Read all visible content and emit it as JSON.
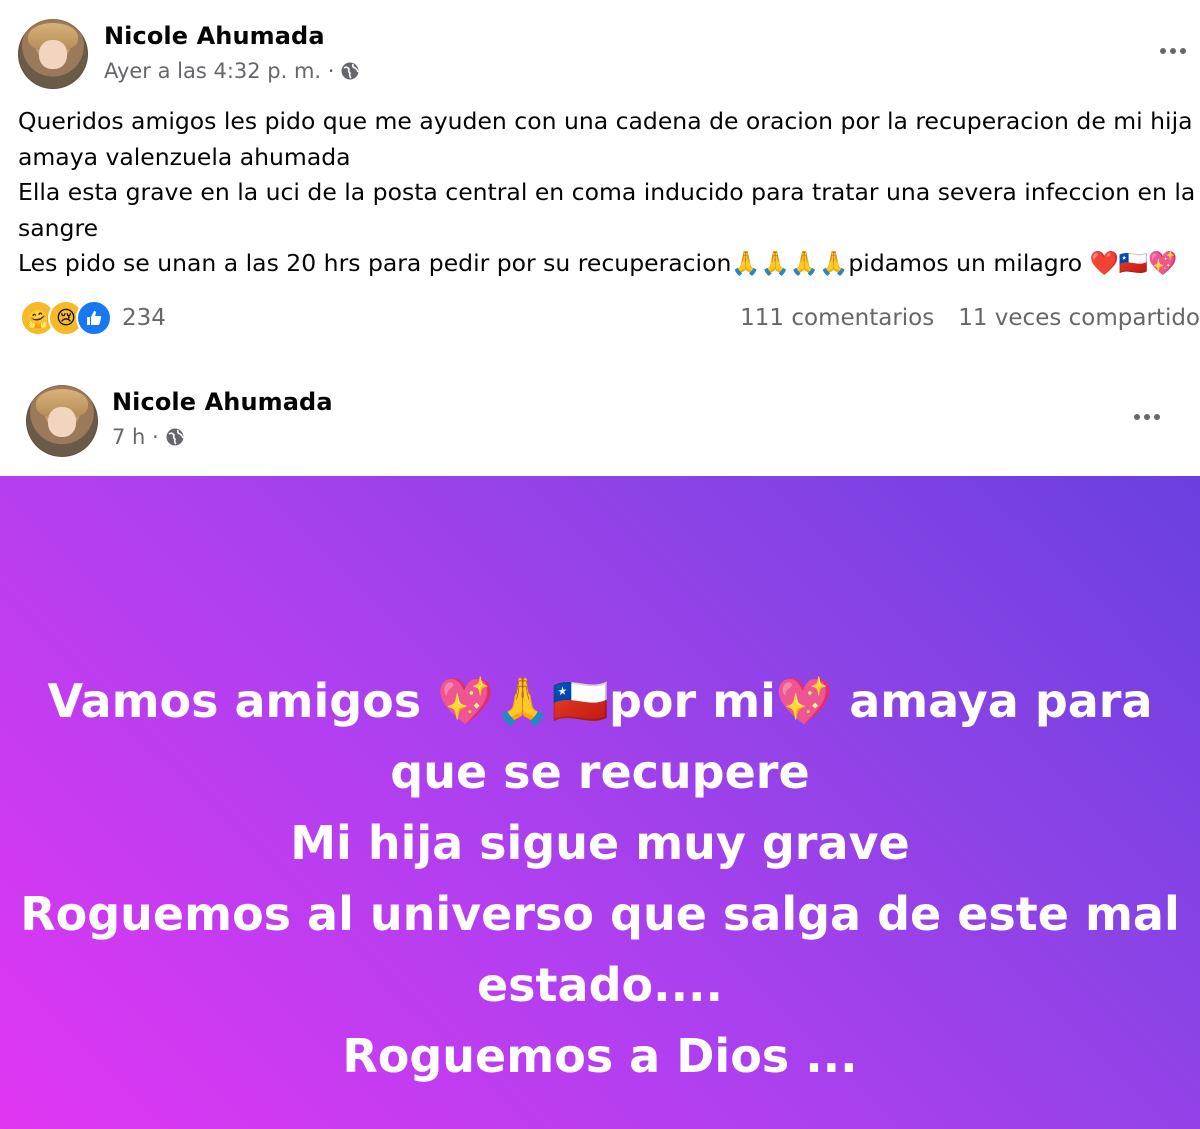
{
  "post1": {
    "author": "Nicole Ahumada",
    "timestamp": "Ayer a las 4:32 p. m. ·",
    "privacy_icon": "globe-icon",
    "lines": [
      "Queridos amigos les pido que me ayuden con una cadena de oracion por la recuperacion de mi hija",
      "amaya valenzuela ahumada",
      "Ella esta grave en la uci de la posta central en coma inducido para tratar una severa infeccion en la",
      "sangre",
      "Les pido se unan a las 20 hrs para pedir por su recuperacion🙏🙏🙏🙏pidamos un milagro ❤️🇨🇱💖"
    ],
    "reactions": {
      "icons": [
        "care-icon",
        "sad-icon",
        "like-icon"
      ],
      "count": "234"
    },
    "comments": "111 comentarios",
    "shares": "11 veces compartido"
  },
  "post2": {
    "author": "Nicole Ahumada",
    "timestamp": "7 h ·",
    "privacy_icon": "globe-icon",
    "banner_lines": [
      "Vamos amigos 💖🙏🇨🇱por mi💖 amaya para",
      "que se recupere",
      "Mi hija sigue muy grave",
      "Roguemos al universo que salga de este mal",
      "estado....",
      "Roguemos a Dios ..."
    ],
    "colors": {
      "gradient_start": "#e136f2",
      "gradient_end": "#6a3fdf"
    }
  }
}
